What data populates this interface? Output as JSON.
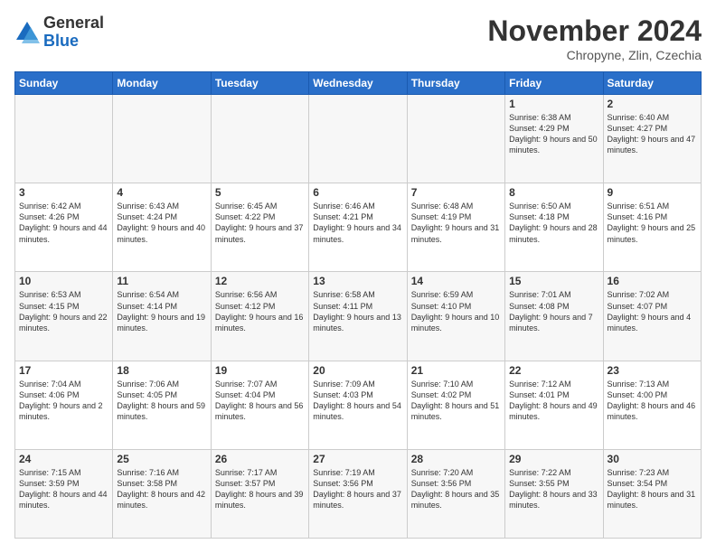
{
  "header": {
    "logo_general": "General",
    "logo_blue": "Blue",
    "month_title": "November 2024",
    "location": "Chropyne, Zlin, Czechia"
  },
  "weekdays": [
    "Sunday",
    "Monday",
    "Tuesday",
    "Wednesday",
    "Thursday",
    "Friday",
    "Saturday"
  ],
  "weeks": [
    [
      {
        "day": "",
        "info": ""
      },
      {
        "day": "",
        "info": ""
      },
      {
        "day": "",
        "info": ""
      },
      {
        "day": "",
        "info": ""
      },
      {
        "day": "",
        "info": ""
      },
      {
        "day": "1",
        "info": "Sunrise: 6:38 AM\nSunset: 4:29 PM\nDaylight: 9 hours and 50 minutes."
      },
      {
        "day": "2",
        "info": "Sunrise: 6:40 AM\nSunset: 4:27 PM\nDaylight: 9 hours and 47 minutes."
      }
    ],
    [
      {
        "day": "3",
        "info": "Sunrise: 6:42 AM\nSunset: 4:26 PM\nDaylight: 9 hours and 44 minutes."
      },
      {
        "day": "4",
        "info": "Sunrise: 6:43 AM\nSunset: 4:24 PM\nDaylight: 9 hours and 40 minutes."
      },
      {
        "day": "5",
        "info": "Sunrise: 6:45 AM\nSunset: 4:22 PM\nDaylight: 9 hours and 37 minutes."
      },
      {
        "day": "6",
        "info": "Sunrise: 6:46 AM\nSunset: 4:21 PM\nDaylight: 9 hours and 34 minutes."
      },
      {
        "day": "7",
        "info": "Sunrise: 6:48 AM\nSunset: 4:19 PM\nDaylight: 9 hours and 31 minutes."
      },
      {
        "day": "8",
        "info": "Sunrise: 6:50 AM\nSunset: 4:18 PM\nDaylight: 9 hours and 28 minutes."
      },
      {
        "day": "9",
        "info": "Sunrise: 6:51 AM\nSunset: 4:16 PM\nDaylight: 9 hours and 25 minutes."
      }
    ],
    [
      {
        "day": "10",
        "info": "Sunrise: 6:53 AM\nSunset: 4:15 PM\nDaylight: 9 hours and 22 minutes."
      },
      {
        "day": "11",
        "info": "Sunrise: 6:54 AM\nSunset: 4:14 PM\nDaylight: 9 hours and 19 minutes."
      },
      {
        "day": "12",
        "info": "Sunrise: 6:56 AM\nSunset: 4:12 PM\nDaylight: 9 hours and 16 minutes."
      },
      {
        "day": "13",
        "info": "Sunrise: 6:58 AM\nSunset: 4:11 PM\nDaylight: 9 hours and 13 minutes."
      },
      {
        "day": "14",
        "info": "Sunrise: 6:59 AM\nSunset: 4:10 PM\nDaylight: 9 hours and 10 minutes."
      },
      {
        "day": "15",
        "info": "Sunrise: 7:01 AM\nSunset: 4:08 PM\nDaylight: 9 hours and 7 minutes."
      },
      {
        "day": "16",
        "info": "Sunrise: 7:02 AM\nSunset: 4:07 PM\nDaylight: 9 hours and 4 minutes."
      }
    ],
    [
      {
        "day": "17",
        "info": "Sunrise: 7:04 AM\nSunset: 4:06 PM\nDaylight: 9 hours and 2 minutes."
      },
      {
        "day": "18",
        "info": "Sunrise: 7:06 AM\nSunset: 4:05 PM\nDaylight: 8 hours and 59 minutes."
      },
      {
        "day": "19",
        "info": "Sunrise: 7:07 AM\nSunset: 4:04 PM\nDaylight: 8 hours and 56 minutes."
      },
      {
        "day": "20",
        "info": "Sunrise: 7:09 AM\nSunset: 4:03 PM\nDaylight: 8 hours and 54 minutes."
      },
      {
        "day": "21",
        "info": "Sunrise: 7:10 AM\nSunset: 4:02 PM\nDaylight: 8 hours and 51 minutes."
      },
      {
        "day": "22",
        "info": "Sunrise: 7:12 AM\nSunset: 4:01 PM\nDaylight: 8 hours and 49 minutes."
      },
      {
        "day": "23",
        "info": "Sunrise: 7:13 AM\nSunset: 4:00 PM\nDaylight: 8 hours and 46 minutes."
      }
    ],
    [
      {
        "day": "24",
        "info": "Sunrise: 7:15 AM\nSunset: 3:59 PM\nDaylight: 8 hours and 44 minutes."
      },
      {
        "day": "25",
        "info": "Sunrise: 7:16 AM\nSunset: 3:58 PM\nDaylight: 8 hours and 42 minutes."
      },
      {
        "day": "26",
        "info": "Sunrise: 7:17 AM\nSunset: 3:57 PM\nDaylight: 8 hours and 39 minutes."
      },
      {
        "day": "27",
        "info": "Sunrise: 7:19 AM\nSunset: 3:56 PM\nDaylight: 8 hours and 37 minutes."
      },
      {
        "day": "28",
        "info": "Sunrise: 7:20 AM\nSunset: 3:56 PM\nDaylight: 8 hours and 35 minutes."
      },
      {
        "day": "29",
        "info": "Sunrise: 7:22 AM\nSunset: 3:55 PM\nDaylight: 8 hours and 33 minutes."
      },
      {
        "day": "30",
        "info": "Sunrise: 7:23 AM\nSunset: 3:54 PM\nDaylight: 8 hours and 31 minutes."
      }
    ]
  ]
}
